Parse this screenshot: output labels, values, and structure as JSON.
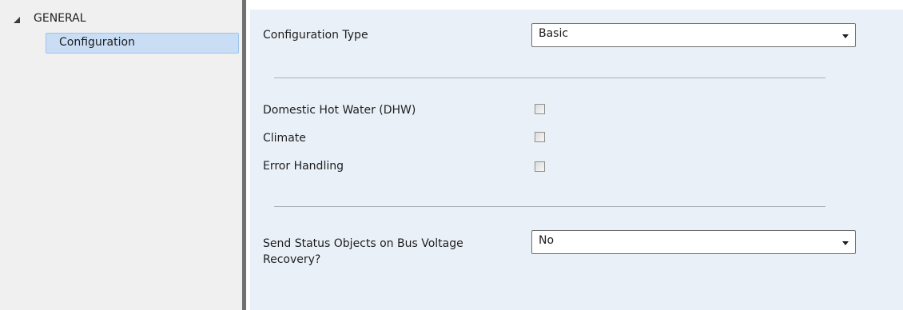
{
  "tree": {
    "root_label": "GENERAL",
    "expanded_icon": "collapse-triangle-icon",
    "selected_item": "Configuration"
  },
  "form": {
    "configuration_type": {
      "label": "Configuration Type",
      "value": "Basic"
    },
    "checkboxes": [
      {
        "label": "Domestic Hot Water (DHW)",
        "checked": false
      },
      {
        "label": "Climate",
        "checked": false
      },
      {
        "label": "Error Handling",
        "checked": false
      }
    ],
    "send_status": {
      "label_line1": "Send Status Objects on Bus Voltage",
      "label_line2": "Recovery?",
      "value": "No"
    }
  },
  "colors": {
    "sidebar_bg": "#f0f0f0",
    "selected_bg": "#c9def5",
    "panel_bg": "#e9f0f7",
    "splitter": "#707070"
  }
}
